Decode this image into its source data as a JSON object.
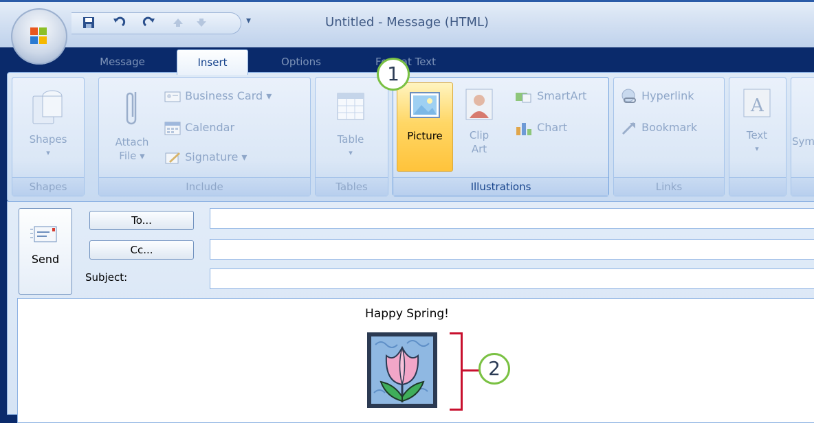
{
  "window": {
    "title": "Untitled - Message (HTML)"
  },
  "qat": {
    "more": "▾"
  },
  "tabs": [
    {
      "label": "Message"
    },
    {
      "label": "Insert"
    },
    {
      "label": "Options"
    },
    {
      "label": "Format Text"
    }
  ],
  "groups": {
    "shapes": {
      "label": "Shapes",
      "button": "Shapes",
      "arrow": "▾"
    },
    "include": {
      "label": "Include",
      "attach_line1": "Attach",
      "attach_line2": "File ▾",
      "business_card": "Business Card ▾",
      "calendar": "Calendar",
      "signature": "Signature ▾"
    },
    "tables": {
      "label": "Tables",
      "button": "Table",
      "arrow": "▾"
    },
    "illustrations": {
      "label": "Illustrations",
      "picture": "Picture",
      "clip_line1": "Clip",
      "clip_line2": "Art",
      "smartart": "SmartArt",
      "chart": "Chart"
    },
    "links": {
      "label": "Links",
      "hyperlink": "Hyperlink",
      "bookmark": "Bookmark"
    },
    "text": {
      "button": "Text",
      "arrow": "▾"
    },
    "symbols": {
      "button": "Sym"
    }
  },
  "callouts": {
    "one": "1",
    "two": "2"
  },
  "compose": {
    "send": "Send",
    "to": "To...",
    "cc": "Cc...",
    "subject_label": "Subject:",
    "to_value": "",
    "cc_value": "",
    "subject_value": "",
    "body_text": "Happy Spring!"
  },
  "colors": {
    "accent": "#15428b",
    "highlight": "#ffd766",
    "callout_ring": "#7ac143",
    "bracket": "#c8102e"
  }
}
